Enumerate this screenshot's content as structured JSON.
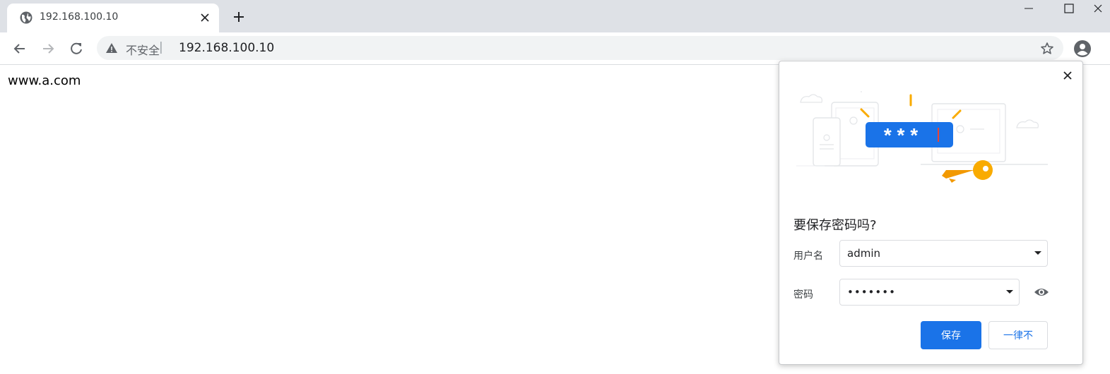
{
  "tab": {
    "title": "192.168.100.10",
    "favicon": "globe-icon"
  },
  "window_controls": [
    "minimize-icon",
    "maximize-icon",
    "close-icon"
  ],
  "toolbar": {
    "security_label": "不安全",
    "separator": "|",
    "url": "192.168.100.10"
  },
  "page": {
    "text": "www.a.com"
  },
  "password_bubble": {
    "title": "要保存密码吗?",
    "username_label": "用户名",
    "username_value": "admin",
    "password_label": "密码",
    "password_value": "•••••••",
    "save_label": "保存",
    "never_label": "一律不",
    "illustration_text": "* * *"
  },
  "colors": {
    "accent": "#1a73e8",
    "tabstrip": "#dee1e6",
    "key": "#f9ab00"
  }
}
